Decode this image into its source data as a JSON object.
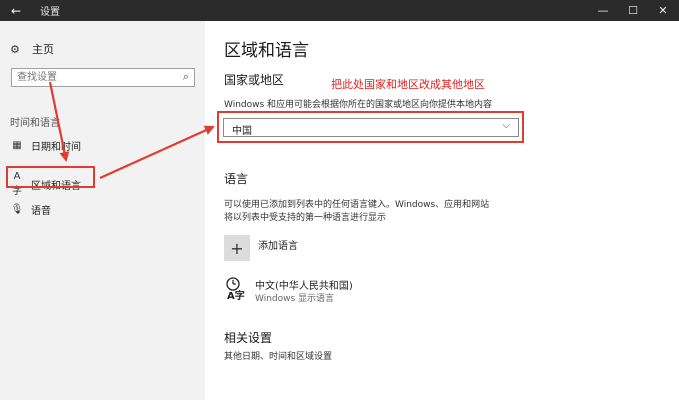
{
  "window": {
    "title": "设置",
    "back_glyph": "←",
    "minimize_glyph": "—",
    "maximize_glyph": "☐",
    "close_glyph": "✕"
  },
  "sidebar": {
    "home_label": "主页",
    "search_placeholder": "查找设置",
    "group_label": "时间和语言",
    "items": [
      {
        "label": "日期和时间",
        "icon": "calendar-clock-icon"
      },
      {
        "label": "区域和语言",
        "icon": "region-language-icon"
      },
      {
        "label": "语音",
        "icon": "microphone-icon"
      }
    ]
  },
  "main": {
    "title": "区域和语言",
    "country_heading": "国家或地区",
    "country_desc": "Windows 和应用可能会根据你所在的国家或地区向你提供本地内容",
    "country_value": "中国",
    "annotation": "把此处国家和地区改成其他地区",
    "language_heading": "语言",
    "language_desc_1": "可以使用已添加到列表中的任何语言键入。Windows、应用和网站",
    "language_desc_2": "将以列表中受支持的第一种语言进行显示",
    "add_language_label": "添加语言",
    "language_item_name": "中文(中华人民共和国)",
    "language_item_sub": "Windows 显示语言",
    "related_heading": "相关设置",
    "related_link": "其他日期、时间和区域设置"
  },
  "colors": {
    "annotation_red": "#e03c31",
    "titlebar": "#2b2b2b",
    "sidebar_bg": "#f2f2f2"
  }
}
